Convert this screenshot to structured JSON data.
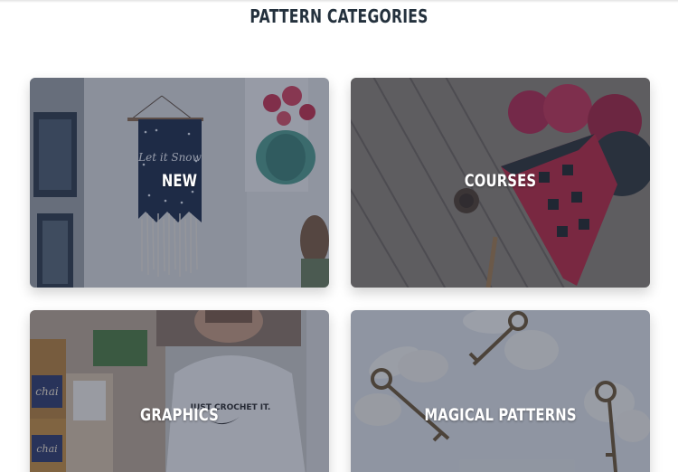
{
  "page": {
    "title": "PATTERN CATEGORIES"
  },
  "categories": [
    {
      "label": "NEW",
      "image": "knit wall hanging in living room"
    },
    {
      "label": "COURSES",
      "image": "crochet heart with yarn on wood"
    },
    {
      "label": "GRAPHICS",
      "image": "woman in crochet sweatshirt"
    },
    {
      "label": "MAGICAL PATTERNS",
      "image": "winged keys on white"
    }
  ],
  "artwork_text": {
    "sweatshirt_print": "JUST CROCHET IT.",
    "banner_text": "Let it Snow",
    "tin_text": "chai"
  },
  "colors": {
    "title": "#24313d",
    "overlay": "rgba(34,44,68,0.42)",
    "label": "#ffffff"
  }
}
